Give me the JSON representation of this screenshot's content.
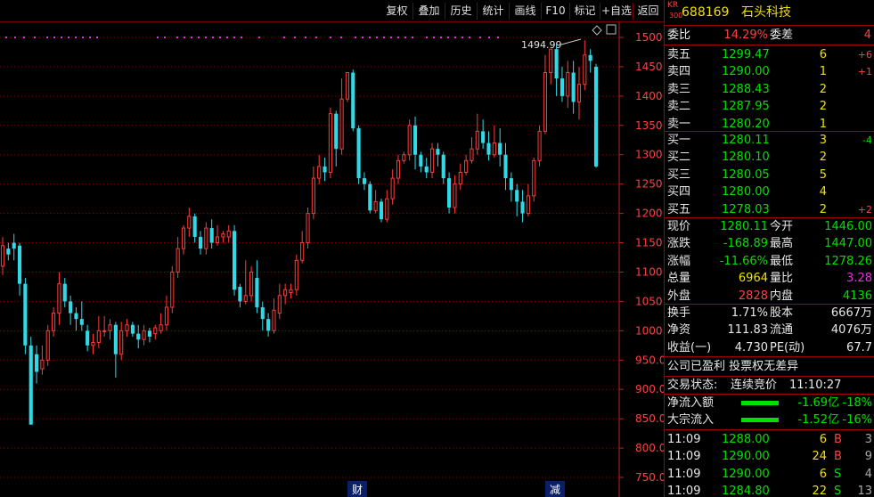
{
  "toolbar": [
    "复权",
    "叠加",
    "历史",
    "统计",
    "画线",
    "F10",
    "标记",
    "+自选",
    "返回"
  ],
  "header": {
    "market_top": "KR",
    "market_bottom": "300",
    "code": "688169",
    "name": "石头科技"
  },
  "colors": {
    "up": "#ff3b3b",
    "down": "#31d9e6",
    "grid": "#7a0000",
    "axis": "#bb2222"
  },
  "chart": {
    "high_label": "1494.99",
    "markers": [
      "财",
      "减"
    ],
    "y_ticks": [
      "1500",
      "1450",
      "1400",
      "1350",
      "1300",
      "1250",
      "1200",
      "1150",
      "1100",
      "1050",
      "1000",
      "950.00",
      "900.00",
      "850.00",
      "800.00",
      "750.00"
    ]
  },
  "chart_data": {
    "type": "candlestick",
    "y_ticks": [
      1500,
      1450,
      1400,
      1350,
      1300,
      1250,
      1200,
      1150,
      1100,
      1050,
      1000,
      950,
      900,
      850,
      800,
      750
    ],
    "ylim": [
      750,
      1500
    ],
    "high_annotation": 1494.99,
    "candles": [
      [
        1110,
        1145,
        1160,
        1095
      ],
      [
        1140,
        1130,
        1150,
        1120
      ],
      [
        1150,
        1140,
        1165,
        1120
      ],
      [
        1145,
        1080,
        1150,
        1060
      ],
      [
        1080,
        975,
        1090,
        960
      ],
      [
        975,
        840,
        990,
        840
      ],
      [
        960,
        930,
        975,
        910
      ],
      [
        935,
        950,
        975,
        925
      ],
      [
        950,
        1000,
        1010,
        940
      ],
      [
        1000,
        1030,
        1040,
        990
      ],
      [
        1030,
        1080,
        1100,
        1010
      ],
      [
        1080,
        1050,
        1090,
        1040
      ],
      [
        1050,
        1030,
        1060,
        1010
      ],
      [
        1030,
        1020,
        1040,
        1000
      ],
      [
        1020,
        1010,
        1050,
        1000
      ],
      [
        1000,
        975,
        1010,
        965
      ],
      [
        975,
        980,
        995,
        960
      ],
      [
        980,
        1000,
        1025,
        970
      ],
      [
        1000,
        1000,
        1025,
        990
      ],
      [
        1000,
        1010,
        1020,
        985
      ],
      [
        1010,
        960,
        1015,
        920
      ],
      [
        960,
        1000,
        1015,
        950
      ],
      [
        1000,
        1010,
        1020,
        990
      ],
      [
        1010,
        995,
        1015,
        990
      ],
      [
        995,
        985,
        1010,
        970
      ],
      [
        985,
        1000,
        1010,
        975
      ],
      [
        1000,
        990,
        1005,
        980
      ],
      [
        995,
        1005,
        1010,
        985
      ],
      [
        1000,
        1010,
        1030,
        995
      ],
      [
        1010,
        1040,
        1060,
        1000
      ],
      [
        1040,
        1100,
        1110,
        1030
      ],
      [
        1100,
        1140,
        1160,
        1090
      ],
      [
        1140,
        1175,
        1180,
        1130
      ],
      [
        1175,
        1195,
        1210,
        1160
      ],
      [
        1195,
        1160,
        1200,
        1150
      ],
      [
        1160,
        1140,
        1170,
        1130
      ],
      [
        1140,
        1175,
        1185,
        1130
      ],
      [
        1175,
        1150,
        1190,
        1140
      ],
      [
        1150,
        1160,
        1180,
        1145
      ],
      [
        1160,
        1165,
        1170,
        1150
      ],
      [
        1160,
        1170,
        1180,
        1150
      ],
      [
        1170,
        1070,
        1180,
        1060
      ],
      [
        1075,
        1050,
        1080,
        1040
      ],
      [
        1050,
        1060,
        1120,
        1045
      ],
      [
        1060,
        1100,
        1110,
        1050
      ],
      [
        1090,
        1040,
        1120,
        1030
      ],
      [
        1040,
        1020,
        1050,
        1000
      ],
      [
        1020,
        1000,
        1030,
        990
      ],
      [
        1000,
        1035,
        1055,
        995
      ],
      [
        1030,
        1060,
        1080,
        1020
      ],
      [
        1060,
        1070,
        1080,
        1045
      ],
      [
        1065,
        1070,
        1080,
        1055
      ],
      [
        1070,
        1120,
        1130,
        1060
      ],
      [
        1120,
        1150,
        1170,
        1115
      ],
      [
        1150,
        1200,
        1210,
        1140
      ],
      [
        1200,
        1260,
        1280,
        1190
      ],
      [
        1260,
        1280,
        1300,
        1250
      ],
      [
        1280,
        1270,
        1295,
        1255
      ],
      [
        1270,
        1370,
        1380,
        1260
      ],
      [
        1370,
        1310,
        1375,
        1280
      ],
      [
        1310,
        1395,
        1430,
        1300
      ],
      [
        1395,
        1440,
        1440,
        1390
      ],
      [
        1440,
        1345,
        1445,
        1340
      ],
      [
        1345,
        1260,
        1350,
        1250
      ],
      [
        1260,
        1250,
        1270,
        1240
      ],
      [
        1250,
        1205,
        1255,
        1200
      ],
      [
        1205,
        1220,
        1240,
        1200
      ],
      [
        1220,
        1190,
        1225,
        1185
      ],
      [
        1190,
        1225,
        1240,
        1185
      ],
      [
        1225,
        1260,
        1275,
        1215
      ],
      [
        1260,
        1290,
        1300,
        1250
      ],
      [
        1290,
        1300,
        1305,
        1285
      ],
      [
        1300,
        1350,
        1360,
        1290
      ],
      [
        1350,
        1300,
        1365,
        1275
      ],
      [
        1300,
        1280,
        1305,
        1270
      ],
      [
        1280,
        1270,
        1295,
        1260
      ],
      [
        1270,
        1310,
        1320,
        1260
      ],
      [
        1310,
        1300,
        1320,
        1280
      ],
      [
        1300,
        1260,
        1305,
        1250
      ],
      [
        1260,
        1210,
        1270,
        1200
      ],
      [
        1210,
        1250,
        1265,
        1200
      ],
      [
        1250,
        1270,
        1285,
        1240
      ],
      [
        1270,
        1290,
        1300,
        1265
      ],
      [
        1290,
        1310,
        1330,
        1285
      ],
      [
        1310,
        1340,
        1370,
        1300
      ],
      [
        1340,
        1320,
        1360,
        1310
      ],
      [
        1320,
        1300,
        1340,
        1290
      ],
      [
        1300,
        1320,
        1350,
        1295
      ],
      [
        1320,
        1300,
        1345,
        1280
      ],
      [
        1300,
        1260,
        1320,
        1240
      ],
      [
        1260,
        1240,
        1270,
        1220
      ],
      [
        1240,
        1220,
        1250,
        1195
      ],
      [
        1220,
        1200,
        1240,
        1185
      ],
      [
        1200,
        1230,
        1250,
        1195
      ],
      [
        1230,
        1290,
        1295,
        1220
      ],
      [
        1290,
        1340,
        1350,
        1280
      ],
      [
        1340,
        1440,
        1470,
        1335
      ],
      [
        1440,
        1480,
        1480,
        1420
      ],
      [
        1480,
        1430,
        1490,
        1400
      ],
      [
        1430,
        1400,
        1450,
        1390
      ],
      [
        1400,
        1440,
        1460,
        1380
      ],
      [
        1440,
        1390,
        1460,
        1370
      ],
      [
        1390,
        1420,
        1450,
        1360
      ],
      [
        1420,
        1470,
        1495,
        1410
      ],
      [
        1470,
        1460,
        1480,
        1440
      ],
      [
        1450,
        1280,
        1455,
        1278
      ]
    ]
  },
  "right_panel": {
    "weibi": {
      "label": "委比",
      "value": "14.29%",
      "label2": "委差",
      "value2": "4"
    },
    "asks": [
      {
        "label": "卖五",
        "price": "1299.47",
        "vol": "6",
        "chg": "+6"
      },
      {
        "label": "卖四",
        "price": "1290.00",
        "vol": "1",
        "chg": "+1"
      },
      {
        "label": "卖三",
        "price": "1288.43",
        "vol": "2",
        "chg": ""
      },
      {
        "label": "卖二",
        "price": "1287.95",
        "vol": "2",
        "chg": ""
      },
      {
        "label": "卖一",
        "price": "1280.20",
        "vol": "1",
        "chg": ""
      }
    ],
    "bids": [
      {
        "label": "买一",
        "price": "1280.11",
        "vol": "3",
        "chg": "-4"
      },
      {
        "label": "买二",
        "price": "1280.10",
        "vol": "2",
        "chg": ""
      },
      {
        "label": "买三",
        "price": "1280.05",
        "vol": "5",
        "chg": ""
      },
      {
        "label": "买四",
        "price": "1280.00",
        "vol": "4",
        "chg": ""
      },
      {
        "label": "买五",
        "price": "1278.03",
        "vol": "2",
        "chg": "+2"
      }
    ],
    "quote": [
      {
        "l1": "现价",
        "v1": "1280.11",
        "c1": "green",
        "l2": "今开",
        "v2": "1446.00",
        "c2": "green"
      },
      {
        "l1": "涨跌",
        "v1": "-168.89",
        "c1": "green",
        "l2": "最高",
        "v2": "1447.00",
        "c2": "green"
      },
      {
        "l1": "涨幅",
        "v1": "-11.66%",
        "c1": "green",
        "l2": "最低",
        "v2": "1278.26",
        "c2": "green"
      },
      {
        "l1": "总量",
        "v1": "6964",
        "c1": "yellow",
        "l2": "量比",
        "v2": "3.28",
        "c2": "mag"
      },
      {
        "l1": "外盘",
        "v1": "2828",
        "c1": "red",
        "l2": "内盘",
        "v2": "4136",
        "c2": "green"
      }
    ],
    "stats": [
      {
        "l1": "换手",
        "v1": "1.71%",
        "l2": "股本",
        "v2": "6667万"
      },
      {
        "l1": "净资",
        "v1": "111.83",
        "l2": "流通",
        "v2": "4076万"
      },
      {
        "l1": "收益(一)",
        "v1": "4.730",
        "l2": "PE(动)",
        "v2": "67.7"
      }
    ],
    "note": "公司已盈利 投票权无差异",
    "status_label": "交易状态:",
    "status_value": "连续竞价",
    "status_time": "11:10:27",
    "flows": [
      {
        "label": "净流入额",
        "value": "-1.69亿",
        "pct": "-18%",
        "bar": 0.7
      },
      {
        "label": "大宗流入",
        "value": "-1.52亿",
        "pct": "-16%",
        "bar": 0.7
      }
    ],
    "ticks": [
      {
        "time": "11:09",
        "price": "1288.00",
        "vol": "6",
        "side": "B",
        "n": "3"
      },
      {
        "time": "11:09",
        "price": "1290.00",
        "vol": "24",
        "side": "B",
        "n": "9"
      },
      {
        "time": "11:09",
        "price": "1290.00",
        "vol": "6",
        "side": "S",
        "n": "4"
      },
      {
        "time": "11:09",
        "price": "1284.80",
        "vol": "22",
        "side": "S",
        "n": "13"
      }
    ]
  }
}
